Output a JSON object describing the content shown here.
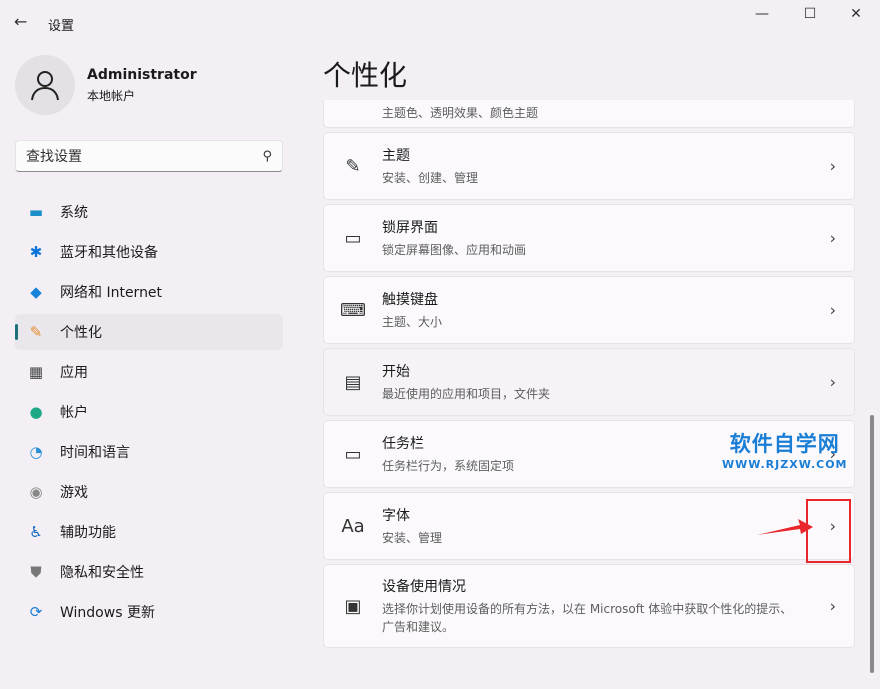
{
  "app_title": "设置",
  "window": {
    "minimize": "—",
    "maximize": "☐",
    "close": "✕"
  },
  "user": {
    "name": "Administrator",
    "type": "本地帐户"
  },
  "search": {
    "placeholder": "查找设置"
  },
  "nav": [
    {
      "label": "系统",
      "icon": "▬",
      "color": "#1a8fc9"
    },
    {
      "label": "蓝牙和其他设备",
      "icon": "✱",
      "color": "#0a74da"
    },
    {
      "label": "网络和 Internet",
      "icon": "◆",
      "color": "#1683d8"
    },
    {
      "label": "个性化",
      "icon": "✎",
      "color": "#e38b2d"
    },
    {
      "label": "应用",
      "icon": "▦",
      "color": "#444"
    },
    {
      "label": "帐户",
      "icon": "●",
      "color": "#1ea886"
    },
    {
      "label": "时间和语言",
      "icon": "◔",
      "color": "#2b8fd6"
    },
    {
      "label": "游戏",
      "icon": "◉",
      "color": "#888"
    },
    {
      "label": "辅助功能",
      "icon": "♿",
      "color": "#1466c0"
    },
    {
      "label": "隐私和安全性",
      "icon": "⛊",
      "color": "#777"
    },
    {
      "label": "Windows 更新",
      "icon": "⟳",
      "color": "#1a7fd6"
    }
  ],
  "page_title": "个性化",
  "cards": [
    {
      "title": "",
      "desc": "主题色、透明效果、颜色主题",
      "icon": ""
    },
    {
      "title": "主题",
      "desc": "安装、创建、管理",
      "icon": "✎"
    },
    {
      "title": "锁屏界面",
      "desc": "锁定屏幕图像、应用和动画",
      "icon": "▭"
    },
    {
      "title": "触摸键盘",
      "desc": "主题、大小",
      "icon": "⌨"
    },
    {
      "title": "开始",
      "desc": "最近使用的应用和项目，文件夹",
      "icon": "▤"
    },
    {
      "title": "任务栏",
      "desc": "任务栏行为，系统固定项",
      "icon": "▭"
    },
    {
      "title": "字体",
      "desc": "安装、管理",
      "icon": "Aa"
    },
    {
      "title": "设备使用情况",
      "desc": "选择你计划使用设备的所有方法，以在 Microsoft 体验中获取个性化的提示、广告和建议。",
      "icon": "▣"
    }
  ],
  "watermark": {
    "name": "软件自学网",
    "url": "WWW.RJZXW.COM"
  },
  "annotation_color": "#e8262b"
}
